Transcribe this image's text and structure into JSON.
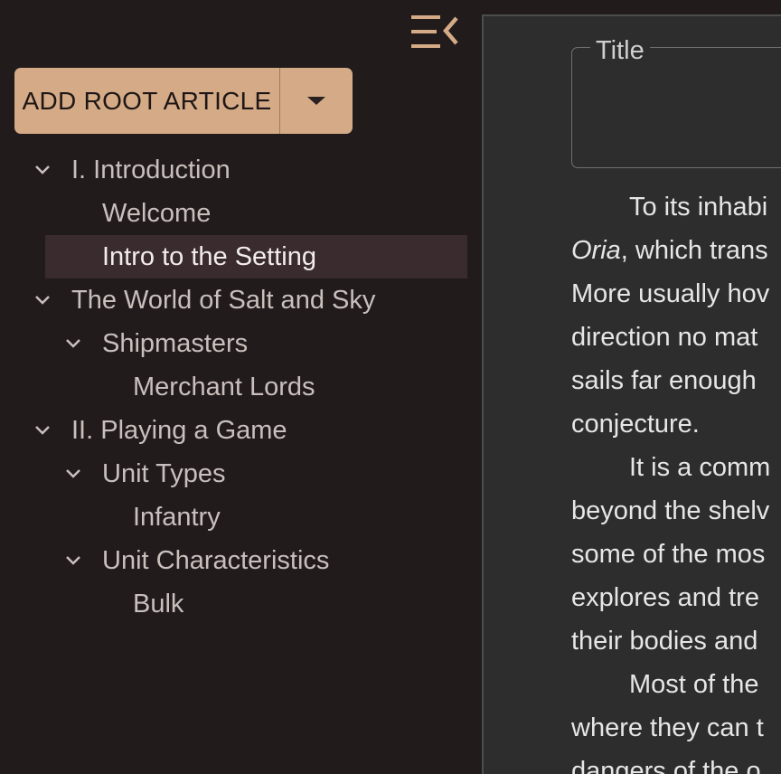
{
  "sidebar": {
    "add_root_label": "ADD ROOT ARTICLE",
    "tree": [
      {
        "label": "I. Introduction",
        "level": 0,
        "chevron": true
      },
      {
        "label": "Welcome",
        "level": 1,
        "chevron": false
      },
      {
        "label": "Intro to the Setting",
        "level": 1,
        "chevron": false,
        "selected": true
      },
      {
        "label": "The World of Salt and Sky",
        "level": 0,
        "chevron": true
      },
      {
        "label": "Shipmasters",
        "level": 1,
        "chevron": true
      },
      {
        "label": "Merchant Lords",
        "level": 2,
        "chevron": false
      },
      {
        "label": "II. Playing a Game",
        "level": 0,
        "chevron": true
      },
      {
        "label": "Unit Types",
        "level": 1,
        "chevron": true
      },
      {
        "label": "Infantry",
        "level": 2,
        "chevron": false
      },
      {
        "label": "Unit Characteristics",
        "level": 1,
        "chevron": true
      },
      {
        "label": "Bulk",
        "level": 2,
        "chevron": false
      }
    ]
  },
  "editor": {
    "title_legend": "Title",
    "title_value": "",
    "lines": [
      {
        "indent": true,
        "text": "To its inhabi"
      },
      {
        "italic": "Oria",
        "text": ", which trans"
      },
      {
        "text": "More usually hov"
      },
      {
        "text": "direction no mat"
      },
      {
        "text": "sails far enough"
      },
      {
        "text": "conjecture."
      },
      {
        "indent": true,
        "text": "It is a comm"
      },
      {
        "text": "beyond the shelv"
      },
      {
        "text": "some of the mos"
      },
      {
        "text": "explores and tre"
      },
      {
        "text": "their bodies and"
      },
      {
        "indent": true,
        "text": "Most of the"
      },
      {
        "text": "where they can t"
      },
      {
        "text": "dangers of the o"
      }
    ]
  },
  "colors": {
    "background": "#211b1b",
    "accent": "#d4ab86",
    "selected_row": "#392b2e",
    "panel": "#2d2d2d"
  }
}
